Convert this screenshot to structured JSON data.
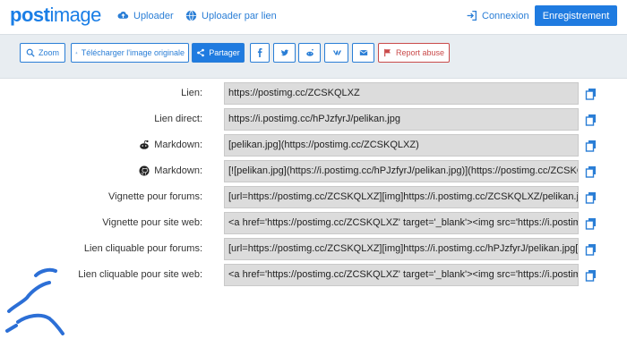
{
  "header": {
    "logo_part1": "post",
    "logo_part2": "image",
    "uploader_label": "Uploader",
    "uploader_link_label": "Uploader par lien",
    "login_label": "Connexion",
    "register_label": "Enregistrement"
  },
  "toolbar": {
    "zoom_label": "Zoom",
    "download_label": "Télécharger l'image originale",
    "share_label": "Partager",
    "report_label": "Report abuse"
  },
  "rows": [
    {
      "label": "Lien:",
      "value": "https://postimg.cc/ZCSKQLXZ"
    },
    {
      "label": "Lien direct:",
      "value": "https://i.postimg.cc/hPJzfyrJ/pelikan.jpg"
    },
    {
      "label": "Markdown:",
      "value": "[pelikan.jpg](https://postimg.cc/ZCSKQLXZ)"
    },
    {
      "label": "Markdown:",
      "value": "[![pelikan.jpg](https://i.postimg.cc/hPJzfyrJ/pelikan.jpg)](https://postimg.cc/ZCSKQLXZ)"
    },
    {
      "label": "Vignette pour forums:",
      "value": "[url=https://postimg.cc/ZCSKQLXZ][img]https://i.postimg.cc/ZCSKQLXZ/pelikan.jpg[/img][/url]"
    },
    {
      "label": "Vignette pour site web:",
      "value": "<a href='https://postimg.cc/ZCSKQLXZ' target='_blank'><img src='https://i.postimg.cc/ZCSKQLXZ/pelikan.jpg' border='0' alt='pelikan'/></a>"
    },
    {
      "label": "Lien cliquable pour forums:",
      "value": "[url=https://postimg.cc/ZCSKQLXZ][img]https://i.postimg.cc/hPJzfyrJ/pelikan.jpg[/img][/url]"
    },
    {
      "label": "Lien cliquable pour site web:",
      "value": "<a href='https://postimg.cc/ZCSKQLXZ' target='_blank'><img src='https://i.postimg.cc/hPJzfyrJ/pelikan.jpg' border='0' alt='pelikan'/></a>"
    }
  ],
  "colors": {
    "brand": "#1a7ee6",
    "accent": "#1f7be0",
    "report": "#c94a4a"
  }
}
